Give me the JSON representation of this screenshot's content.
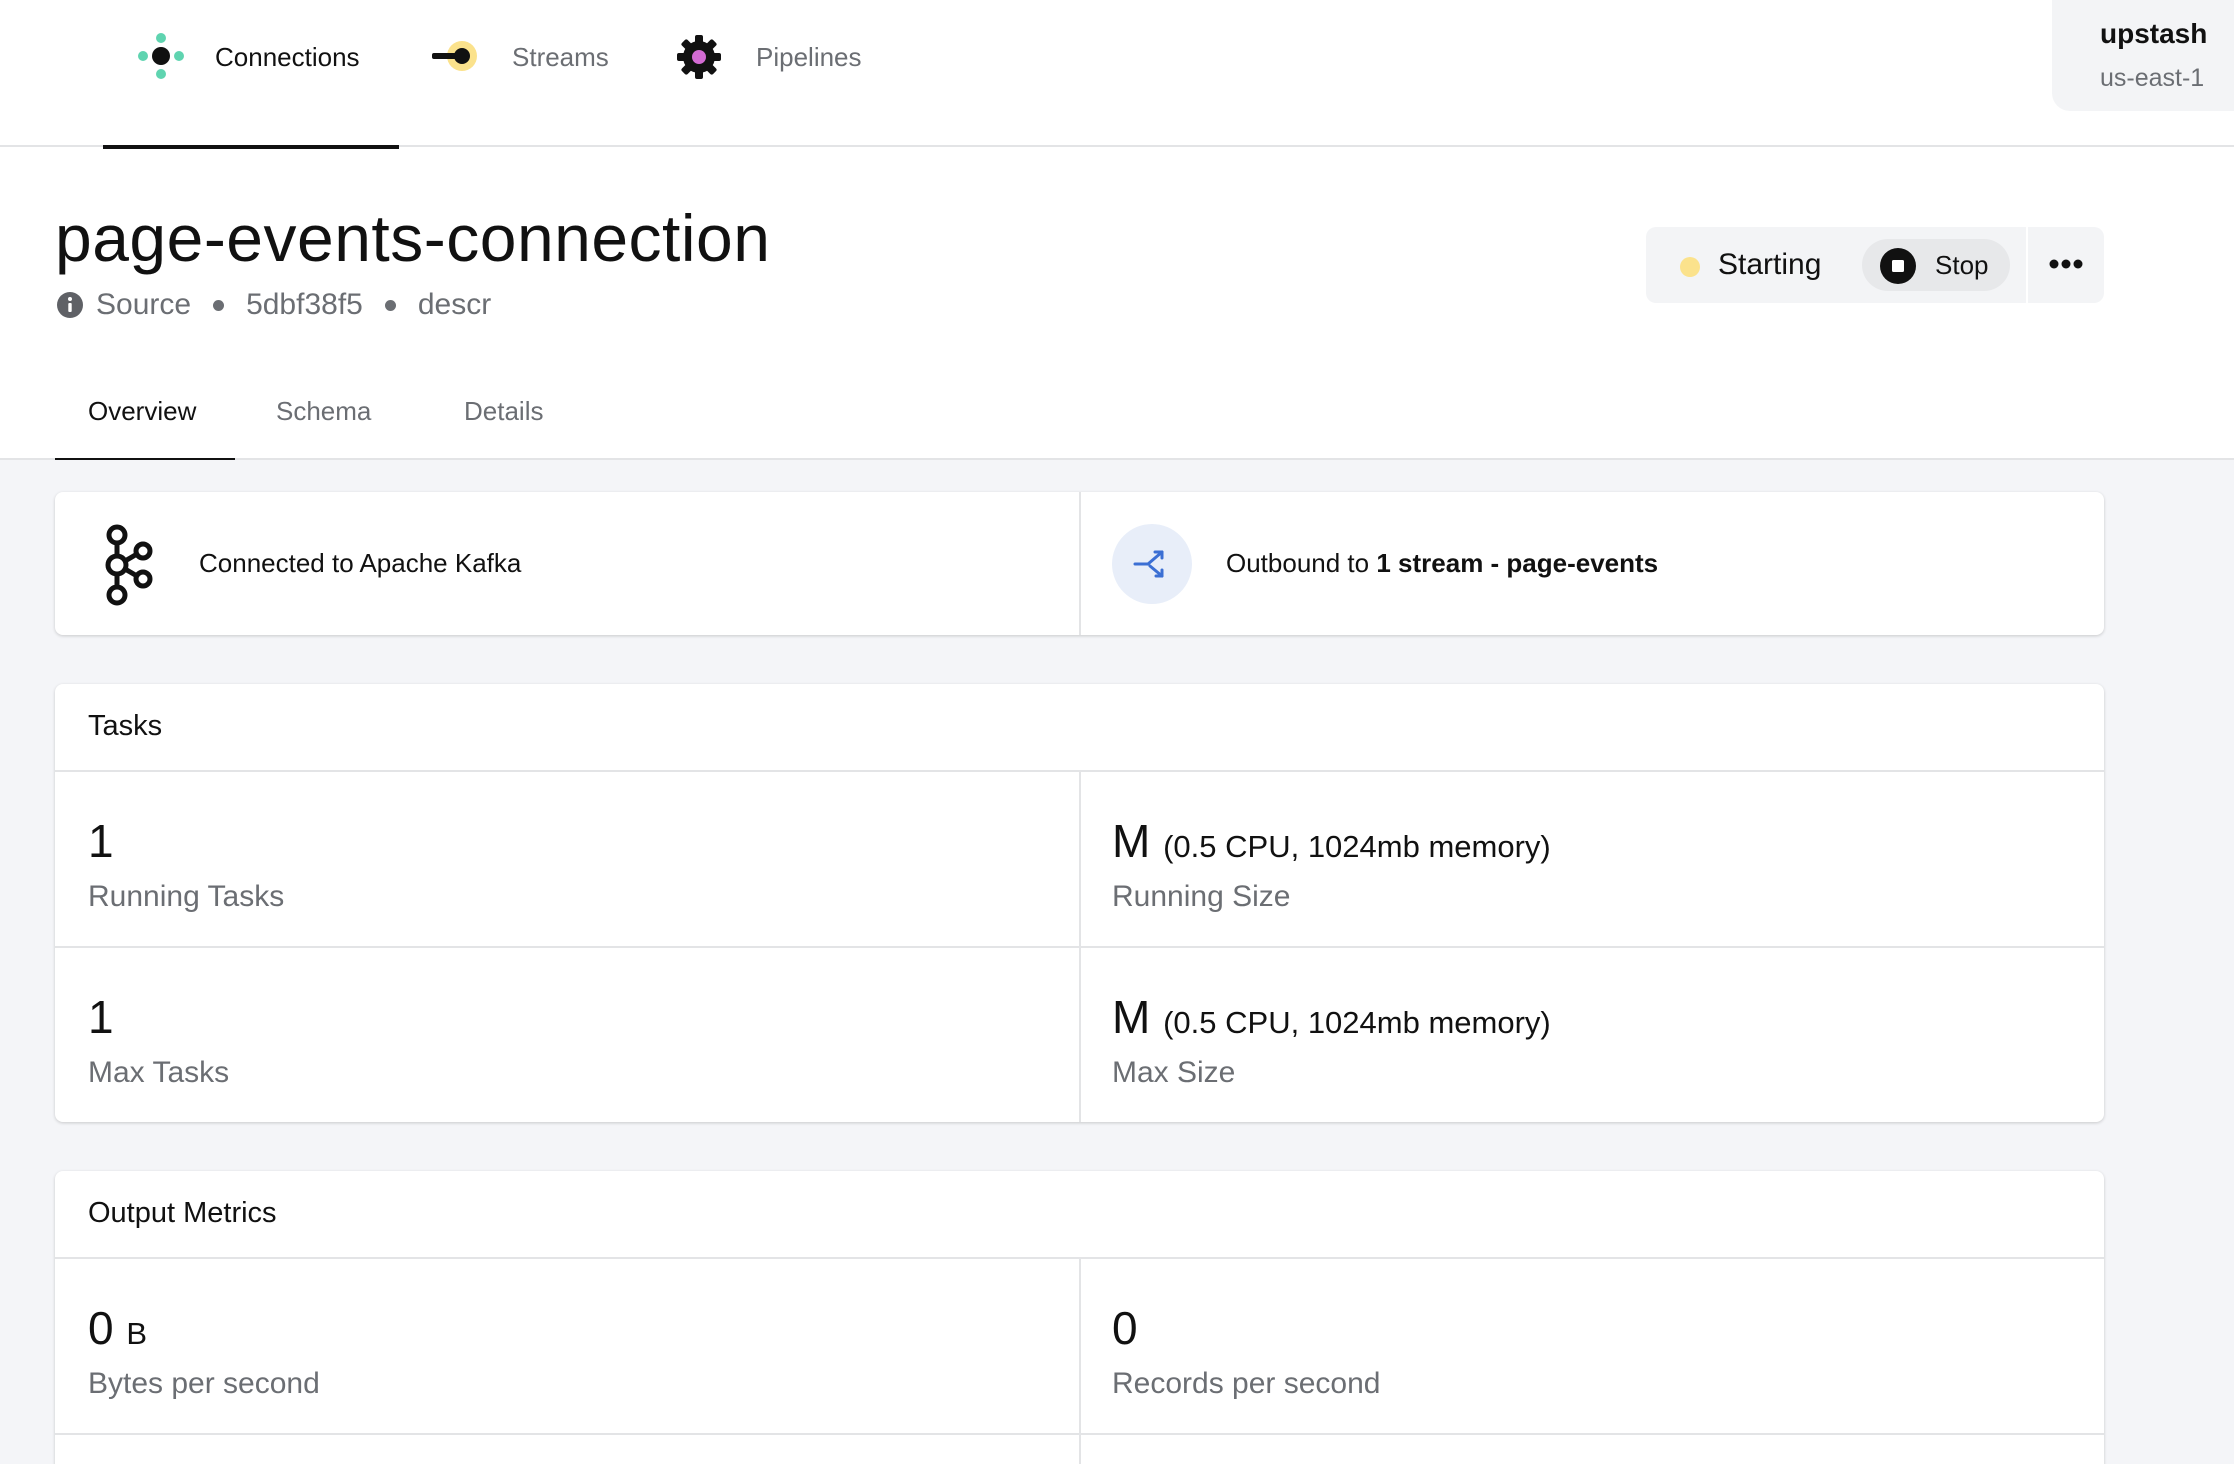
{
  "nav": {
    "tabs": [
      {
        "label": "Connections",
        "icon": "connections-icon"
      },
      {
        "label": "Streams",
        "icon": "streams-icon"
      },
      {
        "label": "Pipelines",
        "icon": "pipelines-icon"
      }
    ],
    "active_tab": "Connections",
    "account": {
      "name": "upstash",
      "region": "us-east-1"
    }
  },
  "header": {
    "title": "page-events-connection",
    "type": "Source",
    "id": "5dbf38f5",
    "description": "descr",
    "status": {
      "label": "Starting",
      "color": "#fbe28c"
    },
    "stop_label": "Stop"
  },
  "subtabs": {
    "items": [
      "Overview",
      "Schema",
      "Details"
    ],
    "active": "Overview"
  },
  "connection": {
    "connected_text": "Connected to Apache Kafka",
    "outbound_prefix": "Outbound to",
    "outbound_target": "1 stream - page-events"
  },
  "tasks": {
    "title": "Tasks",
    "running_tasks": {
      "value": "1",
      "label": "Running Tasks"
    },
    "running_size": {
      "value": "M",
      "detail": "(0.5 CPU, 1024mb memory)",
      "label": "Running Size"
    },
    "max_tasks": {
      "value": "1",
      "label": "Max Tasks"
    },
    "max_size": {
      "value": "M",
      "detail": "(0.5 CPU, 1024mb memory)",
      "label": "Max Size"
    }
  },
  "output_metrics": {
    "title": "Output Metrics",
    "bytes": {
      "value": "0",
      "unit": "B",
      "label": "Bytes per second"
    },
    "records": {
      "value": "0",
      "label": "Records per second"
    }
  },
  "colors": {
    "connections_accent": "#5fd4b0",
    "streams_accent": "#fbe28c",
    "pipelines_accent": "#d36bd3",
    "flow_accent": "#3b6fd4"
  }
}
